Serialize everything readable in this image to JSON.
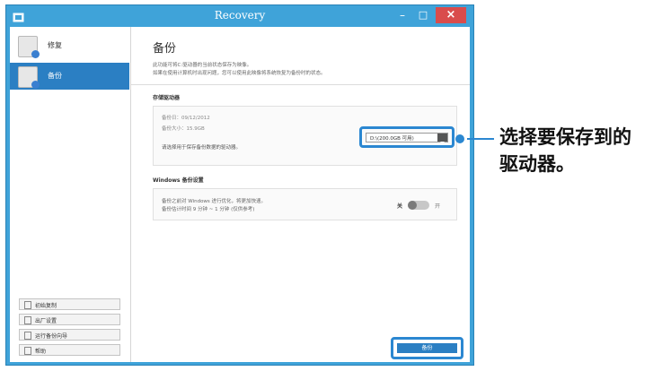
{
  "window": {
    "title": "Recovery",
    "close_symbol": "×",
    "minimize_symbol": "–",
    "maximize_symbol": "□"
  },
  "sidebar": {
    "items": [
      {
        "label": "修复",
        "icon": "restore-icon",
        "active": false
      },
      {
        "label": "备份",
        "icon": "backup-icon",
        "active": true
      }
    ],
    "bottom_buttons": [
      {
        "label": "初始复制"
      },
      {
        "label": "出厂设置"
      },
      {
        "label": "运行备份向导"
      },
      {
        "label": "帮助"
      }
    ]
  },
  "main": {
    "title": "备份",
    "description_line1": "此功能可将C:驱动器的当前状态保存为映像。",
    "description_line2": "如果在使用计算机时出现问题，您可以使用此映像将系统恢复为备份时的状态。",
    "storage_section": {
      "title": "存储驱动器",
      "backup_date": "备份日：09/12/2012",
      "backup_size": "备份大小：15.9GB",
      "select_label": "请选择用于保存备份数据的驱动器。",
      "drive_value": "D:\\(200.0GB 可用)"
    },
    "windows_section": {
      "title": "Windows 备份设置",
      "line1": "备份之前对 Windows 进行优化，将更加快速。",
      "line2": "备份估计时间 9 分钟 ~ 1 分钟 (仅供参考)",
      "toggle_off_label": "关",
      "toggle_on_label": "开",
      "toggle_value": 0
    },
    "backup_button": "备份"
  },
  "callout": {
    "line1": "选择要保存到的",
    "line2": "驱动器。"
  },
  "colors": {
    "window_frame": "#3fa3d9",
    "accent": "#2b7fc3",
    "close_button": "#d94c4c"
  }
}
